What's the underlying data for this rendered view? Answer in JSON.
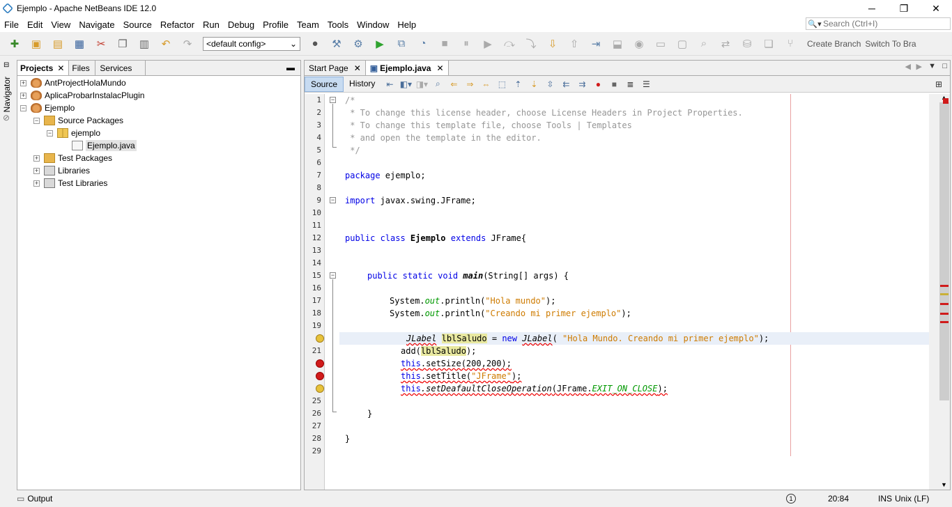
{
  "window": {
    "title": "Ejemplo - Apache NetBeans IDE 12.0",
    "controls": [
      "─",
      "❐",
      "✕"
    ]
  },
  "menu": [
    "File",
    "Edit",
    "View",
    "Navigate",
    "Source",
    "Refactor",
    "Run",
    "Debug",
    "Profile",
    "Team",
    "Tools",
    "Window",
    "Help"
  ],
  "search": {
    "placeholder": "Search (Ctrl+I)"
  },
  "toolbar": {
    "config_value": "<default config>",
    "create_branch": "Create Branch",
    "switch_to_branch": "Switch To Bra"
  },
  "navigator": {
    "label": "Navigator"
  },
  "projects_panel": {
    "tabs": [
      "Projects",
      "Files",
      "Services"
    ],
    "tree": [
      {
        "label": "AntProjectHolaMundo",
        "expander": "+"
      },
      {
        "label": "AplicaProbarInstalacPlugin",
        "expander": "+"
      },
      {
        "label": "Ejemplo",
        "expander": "−"
      },
      {
        "label": "Source Packages",
        "expander": "−"
      },
      {
        "label": "ejemplo",
        "expander": "−"
      },
      {
        "label": "Ejemplo.java",
        "expander": ""
      },
      {
        "label": "Test Packages",
        "expander": "+"
      },
      {
        "label": "Libraries",
        "expander": "+"
      },
      {
        "label": "Test Libraries",
        "expander": "+"
      }
    ]
  },
  "output_bar": {
    "label": "Output"
  },
  "editor": {
    "tabs": [
      "Start Page",
      "Ejemplo.java"
    ],
    "view_tabs": [
      "Source",
      "History"
    ],
    "line_numbers": [
      "1",
      "2",
      "3",
      "4",
      "5",
      "6",
      "7",
      "8",
      "9",
      "10",
      "11",
      "12",
      "13",
      "14",
      "15",
      "16",
      "17",
      "18",
      "19",
      "",
      "21",
      "",
      "",
      "",
      "25",
      "26",
      "27",
      "28",
      "29"
    ],
    "code": {
      "l1": "/*",
      "l2": " * To change this license header, choose License Headers in Project Properties.",
      "l3": " * To change this template file, choose Tools | Templates",
      "l4": " * and open the template in the editor.",
      "l5": " */",
      "l7_kw": "package",
      "l7_rest": " ejemplo;",
      "l9_kw": "import",
      "l9_rest": " javax.swing.JFrame;",
      "l12_kw1": "public class",
      "l12_name": " Ejemplo ",
      "l12_kw2": "extends",
      "l12_rest": " JFrame{",
      "l15_kw": "public static void",
      "l15_name": "main",
      "l15_rest": "(String[] args) {",
      "l17_a": "System.",
      "l17_out": "out",
      "l17_b": ".println(",
      "l17_str": "\"Hola mundo\"",
      "l17_c": ");",
      "l18_a": "System.",
      "l18_out": "out",
      "l18_b": ".println(",
      "l18_str": "\"Creando mi primer ejemplo\"",
      "l18_c": ");",
      "l20_t1": "JLabel",
      "l20_var": "lblSaludo",
      "l20_eq": " = ",
      "l20_new": "new",
      "l20_t2": "JLabel",
      "l20_p": "( ",
      "l20_str": "\"Hola Mundo. Creando mi primer ejemplo\"",
      "l20_end": ");",
      "l21_a": "add(",
      "l21_var": "lblSaludo",
      "l21_b": ");",
      "l22_this": "this",
      "l22_rest": ".setSize(200,200);",
      "l23_this": "this",
      "l23_a": ".setTitle(",
      "l23_str": "\"JFrame\"",
      "l23_b": ");",
      "l24_this": "this",
      "l24_a": ".setDeafaultCloseOperation",
      "l24_b": "(JFrame.",
      "l24_fld": "EXIT_ON_CLOSE",
      "l24_c": ");",
      "l26": "}",
      "l28": "}"
    }
  },
  "status": {
    "notifications": "1",
    "position": "20:84",
    "mode": "INS",
    "line_ending": "Unix (LF)"
  }
}
